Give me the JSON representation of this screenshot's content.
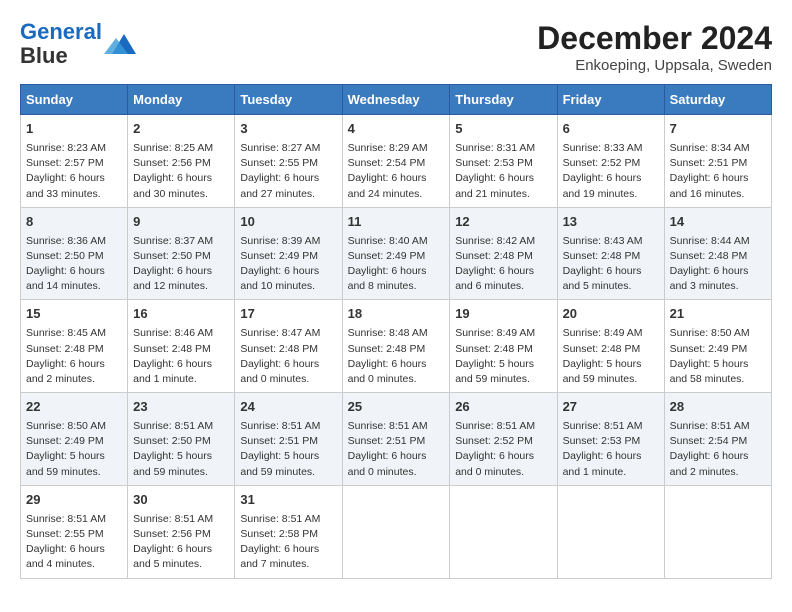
{
  "logo": {
    "line1": "General",
    "line2": "Blue"
  },
  "title": "December 2024",
  "subtitle": "Enkoeping, Uppsala, Sweden",
  "days_of_week": [
    "Sunday",
    "Monday",
    "Tuesday",
    "Wednesday",
    "Thursday",
    "Friday",
    "Saturday"
  ],
  "weeks": [
    [
      {
        "day": "1",
        "rise": "8:23 AM",
        "set": "2:57 PM",
        "daylight_h": "6",
        "daylight_m": "33"
      },
      {
        "day": "2",
        "rise": "8:25 AM",
        "set": "2:56 PM",
        "daylight_h": "6",
        "daylight_m": "30"
      },
      {
        "day": "3",
        "rise": "8:27 AM",
        "set": "2:55 PM",
        "daylight_h": "6",
        "daylight_m": "27"
      },
      {
        "day": "4",
        "rise": "8:29 AM",
        "set": "2:54 PM",
        "daylight_h": "6",
        "daylight_m": "24"
      },
      {
        "day": "5",
        "rise": "8:31 AM",
        "set": "2:53 PM",
        "daylight_h": "6",
        "daylight_m": "21"
      },
      {
        "day": "6",
        "rise": "8:33 AM",
        "set": "2:52 PM",
        "daylight_h": "6",
        "daylight_m": "19"
      },
      {
        "day": "7",
        "rise": "8:34 AM",
        "set": "2:51 PM",
        "daylight_h": "6",
        "daylight_m": "16"
      }
    ],
    [
      {
        "day": "8",
        "rise": "8:36 AM",
        "set": "2:50 PM",
        "daylight_h": "6",
        "daylight_m": "14"
      },
      {
        "day": "9",
        "rise": "8:37 AM",
        "set": "2:50 PM",
        "daylight_h": "6",
        "daylight_m": "12"
      },
      {
        "day": "10",
        "rise": "8:39 AM",
        "set": "2:49 PM",
        "daylight_h": "6",
        "daylight_m": "10"
      },
      {
        "day": "11",
        "rise": "8:40 AM",
        "set": "2:49 PM",
        "daylight_h": "6",
        "daylight_m": "8"
      },
      {
        "day": "12",
        "rise": "8:42 AM",
        "set": "2:48 PM",
        "daylight_h": "6",
        "daylight_m": "6"
      },
      {
        "day": "13",
        "rise": "8:43 AM",
        "set": "2:48 PM",
        "daylight_h": "6",
        "daylight_m": "5"
      },
      {
        "day": "14",
        "rise": "8:44 AM",
        "set": "2:48 PM",
        "daylight_h": "6",
        "daylight_m": "3"
      }
    ],
    [
      {
        "day": "15",
        "rise": "8:45 AM",
        "set": "2:48 PM",
        "daylight_h": "6",
        "daylight_m": "2"
      },
      {
        "day": "16",
        "rise": "8:46 AM",
        "set": "2:48 PM",
        "daylight_h": "6",
        "daylight_m": "1"
      },
      {
        "day": "17",
        "rise": "8:47 AM",
        "set": "2:48 PM",
        "daylight_h": "6",
        "daylight_m": "0"
      },
      {
        "day": "18",
        "rise": "8:48 AM",
        "set": "2:48 PM",
        "daylight_h": "6",
        "daylight_m": "0"
      },
      {
        "day": "19",
        "rise": "8:49 AM",
        "set": "2:48 PM",
        "daylight_h": "5",
        "daylight_m": "59"
      },
      {
        "day": "20",
        "rise": "8:49 AM",
        "set": "2:48 PM",
        "daylight_h": "5",
        "daylight_m": "59"
      },
      {
        "day": "21",
        "rise": "8:50 AM",
        "set": "2:49 PM",
        "daylight_h": "5",
        "daylight_m": "58"
      }
    ],
    [
      {
        "day": "22",
        "rise": "8:50 AM",
        "set": "2:49 PM",
        "daylight_h": "5",
        "daylight_m": "59"
      },
      {
        "day": "23",
        "rise": "8:51 AM",
        "set": "2:50 PM",
        "daylight_h": "5",
        "daylight_m": "59"
      },
      {
        "day": "24",
        "rise": "8:51 AM",
        "set": "2:51 PM",
        "daylight_h": "5",
        "daylight_m": "59"
      },
      {
        "day": "25",
        "rise": "8:51 AM",
        "set": "2:51 PM",
        "daylight_h": "6",
        "daylight_m": "0"
      },
      {
        "day": "26",
        "rise": "8:51 AM",
        "set": "2:52 PM",
        "daylight_h": "6",
        "daylight_m": "0"
      },
      {
        "day": "27",
        "rise": "8:51 AM",
        "set": "2:53 PM",
        "daylight_h": "6",
        "daylight_m": "1"
      },
      {
        "day": "28",
        "rise": "8:51 AM",
        "set": "2:54 PM",
        "daylight_h": "6",
        "daylight_m": "2"
      }
    ],
    [
      {
        "day": "29",
        "rise": "8:51 AM",
        "set": "2:55 PM",
        "daylight_h": "6",
        "daylight_m": "4"
      },
      {
        "day": "30",
        "rise": "8:51 AM",
        "set": "2:56 PM",
        "daylight_h": "6",
        "daylight_m": "5"
      },
      {
        "day": "31",
        "rise": "8:51 AM",
        "set": "2:58 PM",
        "daylight_h": "6",
        "daylight_m": "7"
      },
      null,
      null,
      null,
      null
    ]
  ],
  "labels": {
    "sunrise": "Sunrise:",
    "sunset": "Sunset:",
    "daylight": "Daylight: {h} hours and {m} minutes."
  }
}
